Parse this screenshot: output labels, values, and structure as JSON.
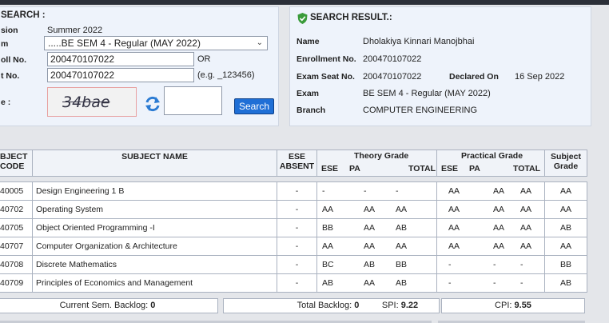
{
  "search": {
    "title": "SEARCH :",
    "session_label": "sion",
    "session_value": "Summer 2022",
    "exam_label": "m",
    "exam_value": ".....BE SEM 4 - Regular (MAY 2022)",
    "rollno_label": "oll No.",
    "rollno_value": "200470107022",
    "or_text": "OR",
    "seatno_label": "t No.",
    "seatno_value": "200470107022",
    "seatno_hint": "(e.g. _123456)",
    "captcha_label": "e :",
    "captcha_text": "34bae",
    "captcha_input": "",
    "search_button": "Search"
  },
  "result": {
    "title": "SEARCH RESULT.:",
    "name_label": "Name",
    "name_value": "Dholakiya Kinnari Manojbhai",
    "enroll_label": "Enrollment No.",
    "enroll_value": "200470107022",
    "seat_label": "Exam Seat No.",
    "seat_value": "200470107022",
    "declared_label": "Declared On",
    "declared_value": "16 Sep 2022",
    "exam_label": "Exam",
    "exam_value": "BE SEM 4 - Regular (MAY 2022)",
    "branch_label": "Branch",
    "branch_value": "COMPUTER ENGINEERING"
  },
  "table": {
    "headers": {
      "code_line1": "BJECT",
      "code_line2": "CODE",
      "name": "SUBJECT NAME",
      "ese_absent_line1": "ESE",
      "ese_absent_line2": "ABSENT",
      "theory": "Theory Grade",
      "practical": "Practical Grade",
      "subject_grade_line1": "Subject",
      "subject_grade_line2": "Grade",
      "ese": "ESE",
      "pa": "PA",
      "total": "TOTAL"
    },
    "rows": [
      {
        "code": "40005",
        "name": "Design Engineering 1 B",
        "absent": "-",
        "t_ese": "-",
        "t_pa": "-",
        "t_total": "-",
        "p_ese": "AA",
        "p_pa": "AA",
        "p_total": "AA",
        "grade": "AA"
      },
      {
        "code": "40702",
        "name": "Operating System",
        "absent": "-",
        "t_ese": "AA",
        "t_pa": "AA",
        "t_total": "AA",
        "p_ese": "AA",
        "p_pa": "AA",
        "p_total": "AA",
        "grade": "AA"
      },
      {
        "code": "40705",
        "name": "Object Oriented Programming -I",
        "absent": "-",
        "t_ese": "BB",
        "t_pa": "AA",
        "t_total": "AB",
        "p_ese": "AA",
        "p_pa": "AA",
        "p_total": "AA",
        "grade": "AB"
      },
      {
        "code": "40707",
        "name": "Computer Organization & Architecture",
        "absent": "-",
        "t_ese": "AA",
        "t_pa": "AA",
        "t_total": "AA",
        "p_ese": "AA",
        "p_pa": "AA",
        "p_total": "AA",
        "grade": "AA"
      },
      {
        "code": "40708",
        "name": "Discrete Mathematics",
        "absent": "-",
        "t_ese": "BC",
        "t_pa": "AB",
        "t_total": "BB",
        "p_ese": "-",
        "p_pa": "-",
        "p_total": "-",
        "grade": "BB"
      },
      {
        "code": "40709",
        "name": "Principles of Economics and Management",
        "absent": "-",
        "t_ese": "AB",
        "t_pa": "AA",
        "t_total": "AB",
        "p_ese": "-",
        "p_pa": "-",
        "p_total": "-",
        "grade": "AB"
      }
    ]
  },
  "footer": {
    "current_backlog_label": "Current Sem. Backlog:",
    "current_backlog_value": "0",
    "total_backlog_label": "Total Backlog:",
    "total_backlog_value": "0",
    "spi_label": "SPI:",
    "spi_value": "9.22",
    "cpi_label": "CPI:",
    "cpi_value": "9.55"
  },
  "colors": {
    "button": "#1f6fd6",
    "panel": "#eef3fb",
    "header_bg": "#f0f3f8"
  }
}
